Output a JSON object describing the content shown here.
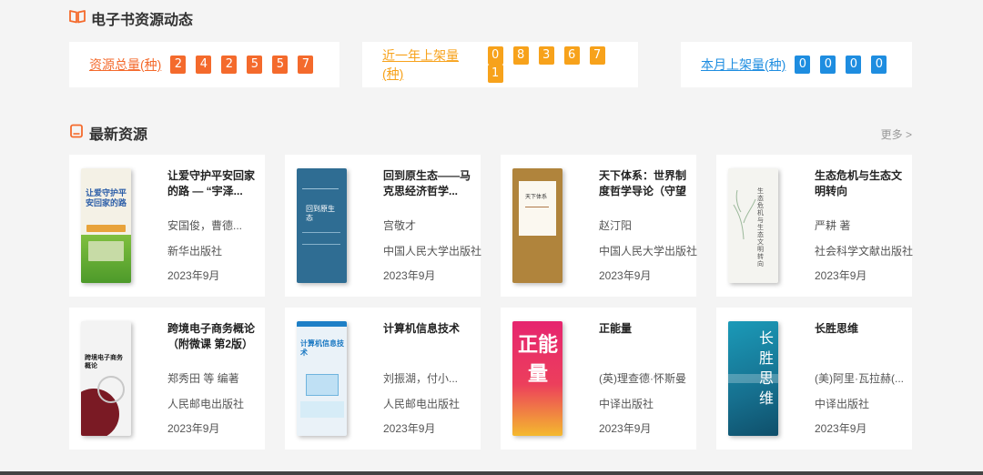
{
  "section1": {
    "title": "电子书资源动态",
    "icon": "open-book-icon"
  },
  "stats": [
    {
      "label": "资源总量(种)",
      "digits": [
        "2",
        "4",
        "2",
        "5",
        "5",
        "7"
      ],
      "color": "#f46a2c"
    },
    {
      "label": "近一年上架量(种)",
      "digits": [
        "0",
        "8",
        "3",
        "6",
        "7",
        "1"
      ],
      "color": "#f7a21b"
    },
    {
      "label": "本月上架量(种)",
      "digits": [
        "0",
        "0",
        "0",
        "0"
      ],
      "color": "#1e8de0"
    }
  ],
  "section2": {
    "title": "最新资源",
    "icon": "book-icon",
    "more": "更多 >"
  },
  "books": [
    {
      "title": "让爱守护平安回家的路 — “宇泽...",
      "author": "安国俊，曹德...",
      "publisher": "新华出版社",
      "date": "2023年9月",
      "cover_title": "让爱守护平安回家的路",
      "cover_bg": "#f1efe6"
    },
    {
      "title": "回到原生态——马克思经济哲学...",
      "author": "宫敬才",
      "publisher": "中国人民大学出版社",
      "date": "2023年9月",
      "cover_title": "回到原生态",
      "cover_bg": "#2f6d93"
    },
    {
      "title": "天下体系：世界制度哲学导论（守望者）",
      "author": "赵汀阳",
      "publisher": "中国人民大学出版社",
      "date": "2023年9月",
      "cover_title": "天下体系",
      "cover_bg": "#b0843c"
    },
    {
      "title": "生态危机与生态文明转向",
      "author": "严耕 著",
      "publisher": "社会科学文献出版社",
      "date": "2023年9月",
      "cover_title": "生态危机与生态文明转向",
      "cover_bg": "#f4f4f0"
    },
    {
      "title": "跨境电子商务概论（附微课 第2版）",
      "author": "郑秀田 等  编著",
      "publisher": "人民邮电出版社",
      "date": "2023年9月",
      "cover_title": "跨境电子商务概论",
      "cover_bg": "#f3f3f3"
    },
    {
      "title": "计算机信息技术",
      "author": "刘振湖，付小...",
      "publisher": "人民邮电出版社",
      "date": "2023年9月",
      "cover_title": "计算机信息技术",
      "cover_bg": "#eaf2f8"
    },
    {
      "title": "正能量",
      "author": "(英)理查德·怀斯曼",
      "publisher": "中译出版社",
      "date": "2023年9月",
      "cover_title": "正能量",
      "cover_bg": "#e6246f"
    },
    {
      "title": "长胜思维",
      "author": "(美)阿里·瓦拉赫(...",
      "publisher": "中译出版社",
      "date": "2023年9月",
      "cover_title": "长胜思维",
      "cover_bg": "#1a84a6"
    }
  ]
}
